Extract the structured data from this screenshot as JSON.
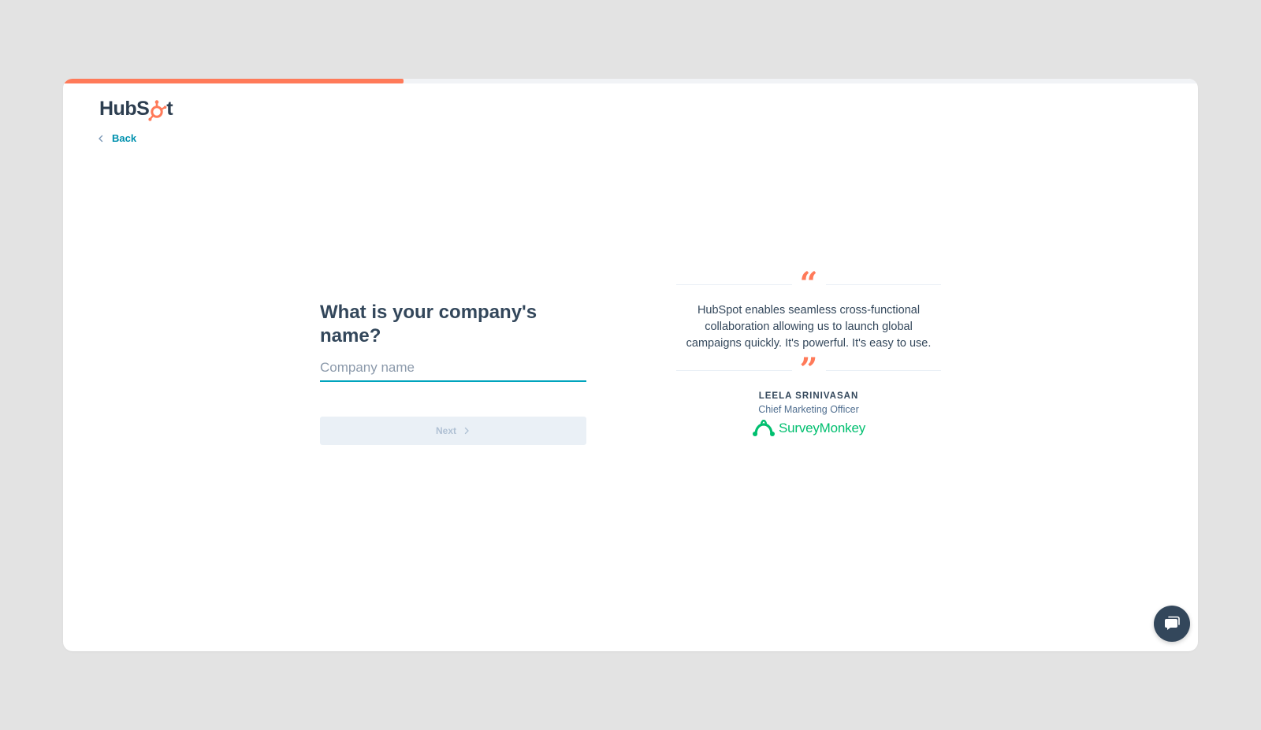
{
  "brand": {
    "logo_before": "HubS",
    "logo_after": "t",
    "accent": "#ff7a59",
    "link_color": "#0091ae",
    "sprocket_icon": "sprocket-icon"
  },
  "progress": {
    "fraction": 0.3
  },
  "nav": {
    "back_label": "Back",
    "back_icon": "chevron-left-icon"
  },
  "form": {
    "question": "What is your company's name?",
    "company_name": {
      "value": "",
      "placeholder": "Company name"
    },
    "next_label": "Next",
    "next_icon": "chevron-right-icon"
  },
  "testimonial": {
    "open_quote": "“",
    "close_quote": "”",
    "quote": "HubSpot enables seamless cross-functional collaboration allowing us to launch global campaigns quickly. It's powerful. It's easy to use.",
    "author_name": "LEELA SRINIVASAN",
    "author_title": "Chief Marketing Officer",
    "company_logo": "SurveyMonkey",
    "company_logo_icon": "surveymonkey-logo-icon",
    "company_color": "#00bf6f"
  },
  "chat": {
    "icon": "chat-icon"
  }
}
